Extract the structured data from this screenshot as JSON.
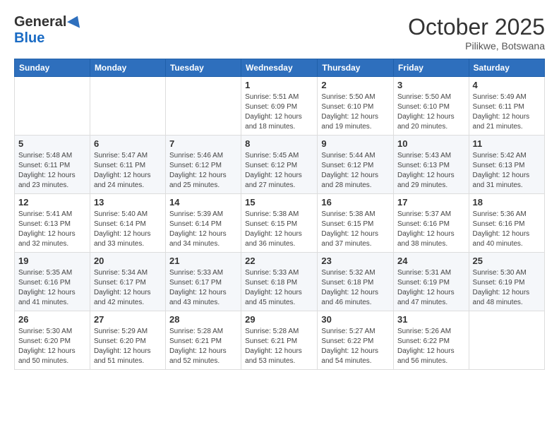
{
  "header": {
    "logo_general": "General",
    "logo_blue": "Blue",
    "month_title": "October 2025",
    "location": "Pilikwe, Botswana"
  },
  "days_of_week": [
    "Sunday",
    "Monday",
    "Tuesday",
    "Wednesday",
    "Thursday",
    "Friday",
    "Saturday"
  ],
  "weeks": [
    [
      {
        "day": "",
        "info": ""
      },
      {
        "day": "",
        "info": ""
      },
      {
        "day": "",
        "info": ""
      },
      {
        "day": "1",
        "info": "Sunrise: 5:51 AM\nSunset: 6:09 PM\nDaylight: 12 hours and 18 minutes."
      },
      {
        "day": "2",
        "info": "Sunrise: 5:50 AM\nSunset: 6:10 PM\nDaylight: 12 hours and 19 minutes."
      },
      {
        "day": "3",
        "info": "Sunrise: 5:50 AM\nSunset: 6:10 PM\nDaylight: 12 hours and 20 minutes."
      },
      {
        "day": "4",
        "info": "Sunrise: 5:49 AM\nSunset: 6:11 PM\nDaylight: 12 hours and 21 minutes."
      }
    ],
    [
      {
        "day": "5",
        "info": "Sunrise: 5:48 AM\nSunset: 6:11 PM\nDaylight: 12 hours and 23 minutes."
      },
      {
        "day": "6",
        "info": "Sunrise: 5:47 AM\nSunset: 6:11 PM\nDaylight: 12 hours and 24 minutes."
      },
      {
        "day": "7",
        "info": "Sunrise: 5:46 AM\nSunset: 6:12 PM\nDaylight: 12 hours and 25 minutes."
      },
      {
        "day": "8",
        "info": "Sunrise: 5:45 AM\nSunset: 6:12 PM\nDaylight: 12 hours and 27 minutes."
      },
      {
        "day": "9",
        "info": "Sunrise: 5:44 AM\nSunset: 6:12 PM\nDaylight: 12 hours and 28 minutes."
      },
      {
        "day": "10",
        "info": "Sunrise: 5:43 AM\nSunset: 6:13 PM\nDaylight: 12 hours and 29 minutes."
      },
      {
        "day": "11",
        "info": "Sunrise: 5:42 AM\nSunset: 6:13 PM\nDaylight: 12 hours and 31 minutes."
      }
    ],
    [
      {
        "day": "12",
        "info": "Sunrise: 5:41 AM\nSunset: 6:13 PM\nDaylight: 12 hours and 32 minutes."
      },
      {
        "day": "13",
        "info": "Sunrise: 5:40 AM\nSunset: 6:14 PM\nDaylight: 12 hours and 33 minutes."
      },
      {
        "day": "14",
        "info": "Sunrise: 5:39 AM\nSunset: 6:14 PM\nDaylight: 12 hours and 34 minutes."
      },
      {
        "day": "15",
        "info": "Sunrise: 5:38 AM\nSunset: 6:15 PM\nDaylight: 12 hours and 36 minutes."
      },
      {
        "day": "16",
        "info": "Sunrise: 5:38 AM\nSunset: 6:15 PM\nDaylight: 12 hours and 37 minutes."
      },
      {
        "day": "17",
        "info": "Sunrise: 5:37 AM\nSunset: 6:16 PM\nDaylight: 12 hours and 38 minutes."
      },
      {
        "day": "18",
        "info": "Sunrise: 5:36 AM\nSunset: 6:16 PM\nDaylight: 12 hours and 40 minutes."
      }
    ],
    [
      {
        "day": "19",
        "info": "Sunrise: 5:35 AM\nSunset: 6:16 PM\nDaylight: 12 hours and 41 minutes."
      },
      {
        "day": "20",
        "info": "Sunrise: 5:34 AM\nSunset: 6:17 PM\nDaylight: 12 hours and 42 minutes."
      },
      {
        "day": "21",
        "info": "Sunrise: 5:33 AM\nSunset: 6:17 PM\nDaylight: 12 hours and 43 minutes."
      },
      {
        "day": "22",
        "info": "Sunrise: 5:33 AM\nSunset: 6:18 PM\nDaylight: 12 hours and 45 minutes."
      },
      {
        "day": "23",
        "info": "Sunrise: 5:32 AM\nSunset: 6:18 PM\nDaylight: 12 hours and 46 minutes."
      },
      {
        "day": "24",
        "info": "Sunrise: 5:31 AM\nSunset: 6:19 PM\nDaylight: 12 hours and 47 minutes."
      },
      {
        "day": "25",
        "info": "Sunrise: 5:30 AM\nSunset: 6:19 PM\nDaylight: 12 hours and 48 minutes."
      }
    ],
    [
      {
        "day": "26",
        "info": "Sunrise: 5:30 AM\nSunset: 6:20 PM\nDaylight: 12 hours and 50 minutes."
      },
      {
        "day": "27",
        "info": "Sunrise: 5:29 AM\nSunset: 6:20 PM\nDaylight: 12 hours and 51 minutes."
      },
      {
        "day": "28",
        "info": "Sunrise: 5:28 AM\nSunset: 6:21 PM\nDaylight: 12 hours and 52 minutes."
      },
      {
        "day": "29",
        "info": "Sunrise: 5:28 AM\nSunset: 6:21 PM\nDaylight: 12 hours and 53 minutes."
      },
      {
        "day": "30",
        "info": "Sunrise: 5:27 AM\nSunset: 6:22 PM\nDaylight: 12 hours and 54 minutes."
      },
      {
        "day": "31",
        "info": "Sunrise: 5:26 AM\nSunset: 6:22 PM\nDaylight: 12 hours and 56 minutes."
      },
      {
        "day": "",
        "info": ""
      }
    ]
  ]
}
